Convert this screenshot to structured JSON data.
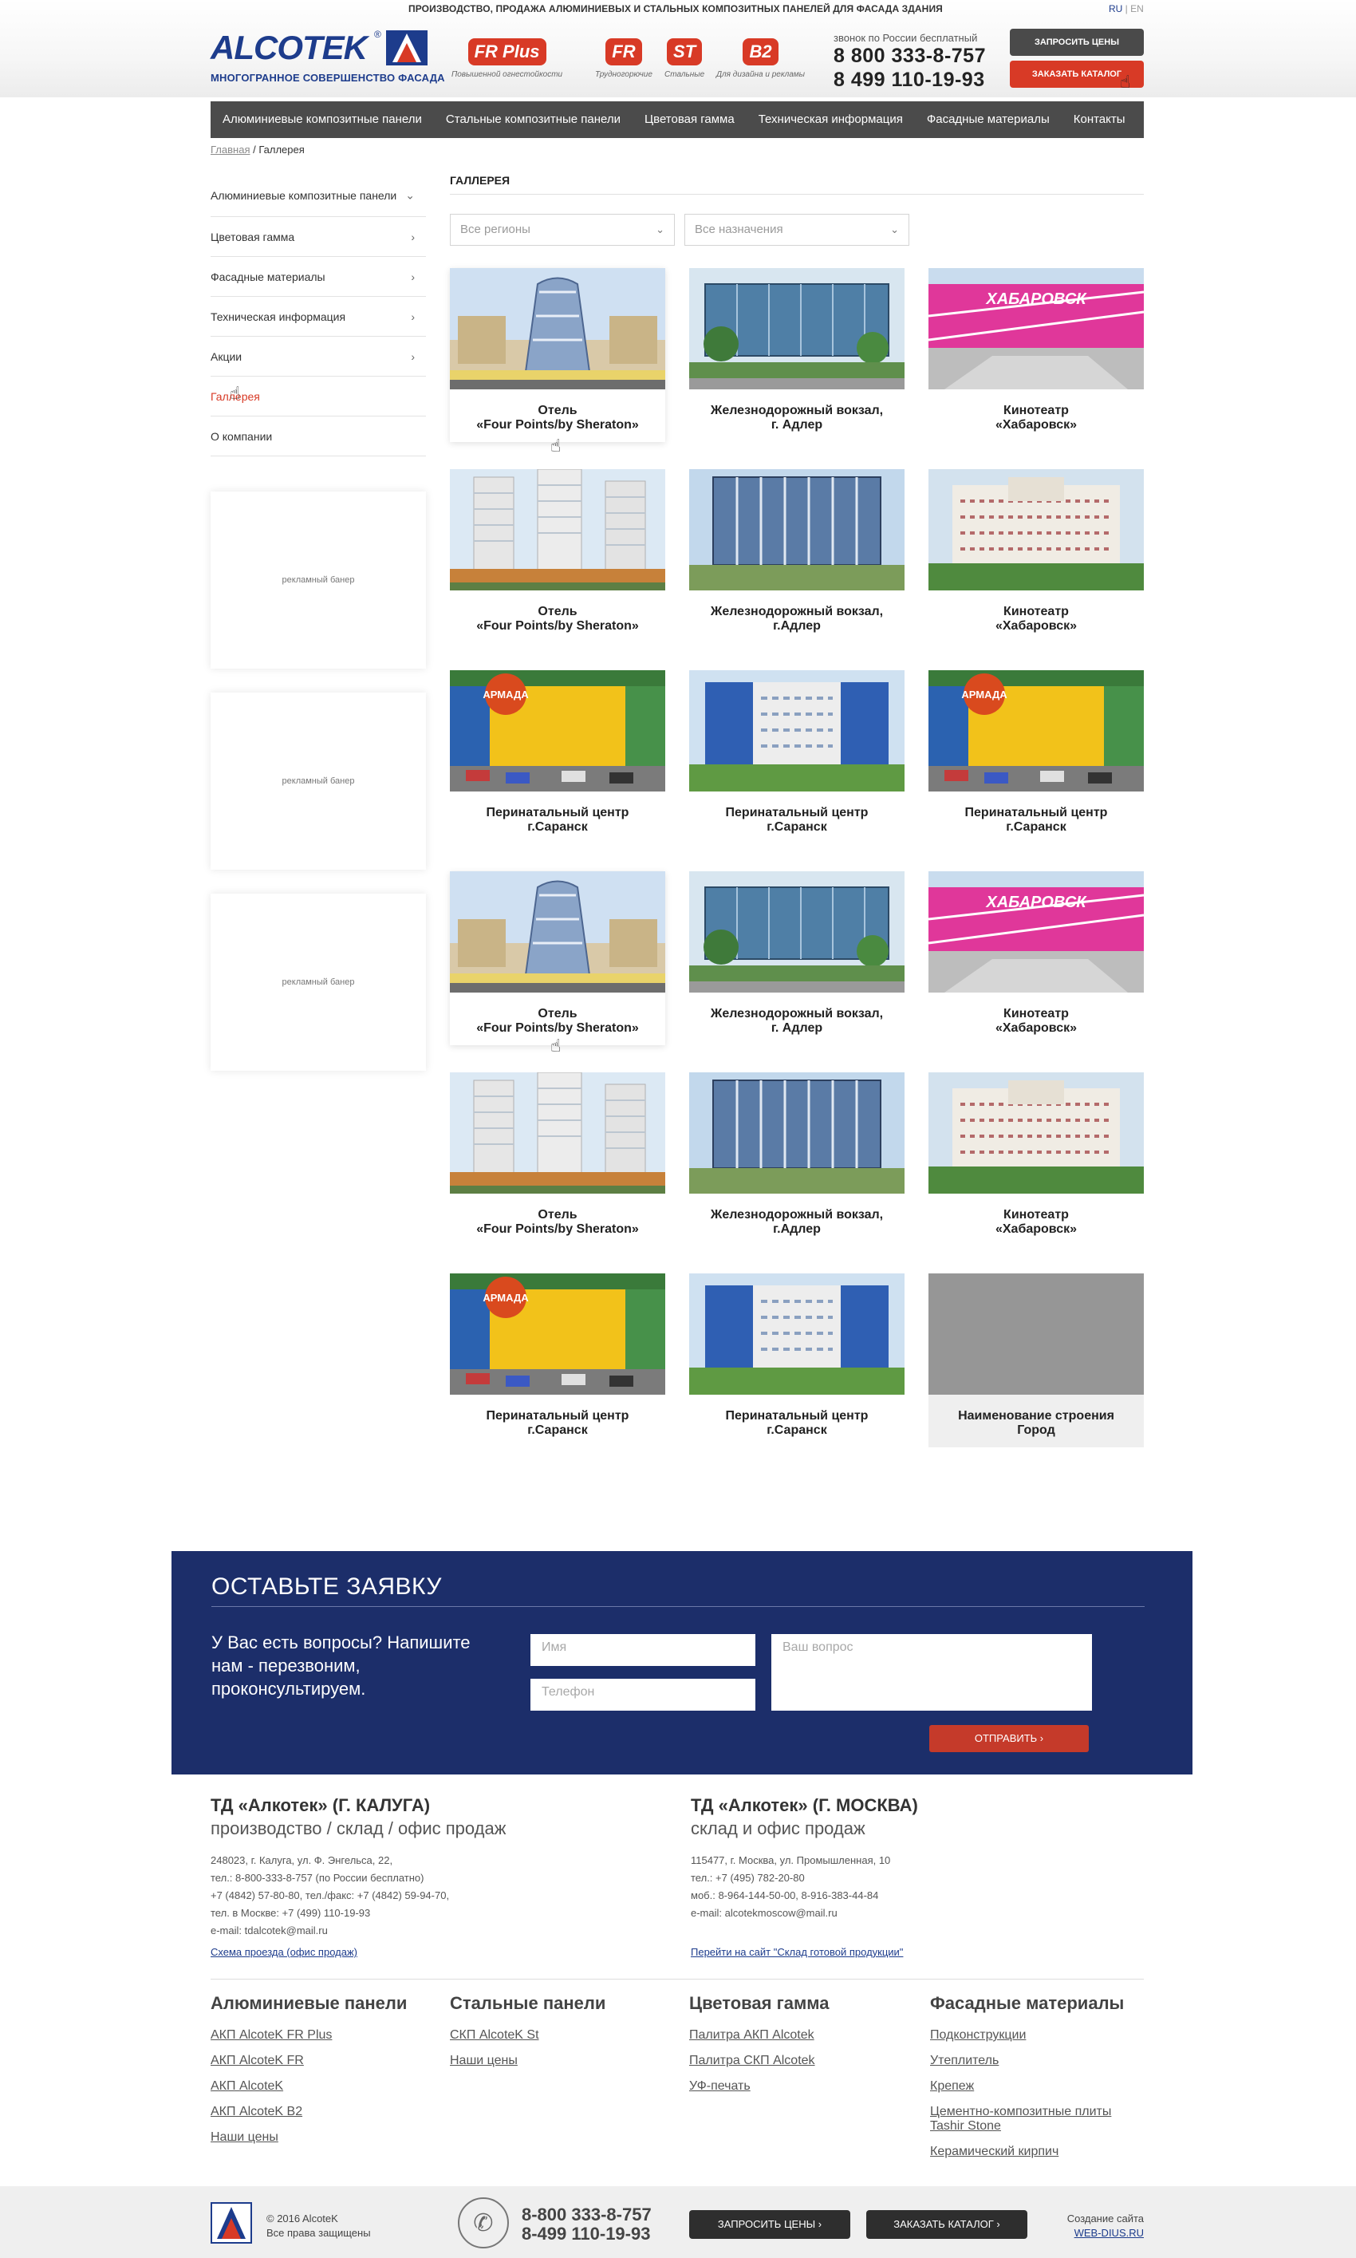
{
  "header": {
    "tagline": "ПРОИЗВОДСТВО, ПРОДАЖА АЛЮМИНИЕВЫХ И СТАЛЬНЫХ КОМПОЗИТНЫХ ПАНЕЛЕЙ ДЛЯ ФАСАДА ЗДАНИЯ",
    "lang_ru": "RU",
    "lang_sep": " | ",
    "lang_en": "EN",
    "logo_text": "ALCOTEK",
    "logo_subtitle": "МНОГОГРАННОЕ СОВЕРШЕНСТВО ФАСАДА",
    "badges": [
      {
        "label": "FR Plus",
        "caption": "Повышенной огнестойкости"
      },
      {
        "label": "FR",
        "caption": "Трудногорючие"
      },
      {
        "label": "ST",
        "caption": "Стальные"
      },
      {
        "label": "B2",
        "caption": "Для дизайна и рекламы"
      }
    ],
    "phone_note": "звонок по России бесплатный",
    "phone_1": "8 800 333-8-757",
    "phone_2": "8 499 110-19-93",
    "btn_prices": "ЗАПРОСИТЬ ЦЕНЫ",
    "btn_catalog": "ЗАКАЗАТЬ КАТАЛОГ"
  },
  "nav": [
    "Алюминиевые композитные панели",
    "Стальные композитные панели",
    "Цветовая гамма",
    "Техническая информация",
    "Фасадные материалы",
    "Контакты"
  ],
  "breadcrumb": {
    "home": "Главная",
    "sep": " / ",
    "current": "Галлерея"
  },
  "sidebar": [
    {
      "label": "Алюминиевые композитные панели",
      "state": "expanded"
    },
    {
      "label": "Цветовая гамма"
    },
    {
      "label": "Фасадные материалы"
    },
    {
      "label": "Техническая информация"
    },
    {
      "label": "Акции"
    },
    {
      "label": "Галлерея",
      "state": "active"
    },
    {
      "label": "О компании"
    }
  ],
  "ads": [
    "рекламный банер",
    "рекламный банер",
    "рекламный банер"
  ],
  "gallery": {
    "title": "ГАЛЛЕРЕЯ",
    "filter_region": "Все регионы",
    "filter_purpose": "Все назначения",
    "items": [
      {
        "l1": "Отель",
        "l2": "«Four Points/by Sheraton»",
        "pic": "hotel-dome"
      },
      {
        "l1": "Железнодорожный вокзал,",
        "l2": "г. Адлер",
        "pic": "station-glass"
      },
      {
        "l1": "Кинотеатр",
        "l2": "«Хабаровск»",
        "pic": "cinema-pink"
      },
      {
        "l1": "Отель",
        "l2": "«Four Points/by Sheraton»",
        "pic": "towers"
      },
      {
        "l1": "Железнодорожный вокзал,",
        "l2": "г.Адлер",
        "pic": "station-blue"
      },
      {
        "l1": "Кинотеатр",
        "l2": "«Хабаровск»",
        "pic": "cinema-white"
      },
      {
        "l1": "Перинатальный центр",
        "l2": "г.Саранск",
        "pic": "mall-yellow"
      },
      {
        "l1": "Перинатальный центр",
        "l2": "г.Саранск",
        "pic": "hospital-blue"
      },
      {
        "l1": "Перинатальный центр",
        "l2": "г.Саранск",
        "pic": "mall-yellow"
      },
      {
        "l1": "Отель",
        "l2": "«Four Points/by Sheraton»",
        "pic": "hotel-dome"
      },
      {
        "l1": "Железнодорожный вокзал,",
        "l2": "г. Адлер",
        "pic": "station-glass"
      },
      {
        "l1": "Кинотеатр",
        "l2": "«Хабаровск»",
        "pic": "cinema-pink"
      },
      {
        "l1": "Отель",
        "l2": "«Four Points/by Sheraton»",
        "pic": "towers"
      },
      {
        "l1": "Железнодорожный вокзал,",
        "l2": "г.Адлер",
        "pic": "station-blue"
      },
      {
        "l1": "Кинотеатр",
        "l2": "«Хабаровск»",
        "pic": "cinema-white"
      },
      {
        "l1": "Перинатальный центр",
        "l2": "г.Саранск",
        "pic": "mall-yellow"
      },
      {
        "l1": "Перинатальный центр",
        "l2": "г.Саранск",
        "pic": "hospital-blue"
      },
      {
        "l1": "Наименование строения",
        "l2": "Город",
        "pic": "placeholder"
      }
    ]
  },
  "cinema_sign": "ХАБАРОВСК",
  "mall_sign": "АРМАДА",
  "form": {
    "title": "ОСТАВЬТЕ ЗАЯВКУ",
    "text": "У Вас есть вопросы? Напишите нам - перезвоним, проконсультируем.",
    "name_placeholder": "Имя",
    "phone_placeholder": "Телефон",
    "question_placeholder": "Ваш вопрос",
    "send": "ОТПРАВИТЬ  ›"
  },
  "offices": [
    {
      "title": "ТД «Алкотек» (Г. КАЛУГА)",
      "subtitle": "производство / склад / офис продаж",
      "lines": [
        "248023, г. Калуга, ул. Ф. Энгельса, 22,",
        "тел.: 8-800-333-8-757 (по России бесплатно)",
        "+7 (4842) 57-80-80, тел./факс: +7 (4842) 59-94-70,",
        "тел. в Москве: +7 (499) 110-19-93",
        "e-mail: tdalcotek@mail.ru"
      ],
      "link": "Схема проезда (офис продаж)"
    },
    {
      "title": "ТД «Алкотек» (Г. МОСКВА)",
      "subtitle": "склад и офис продаж",
      "lines": [
        "115477, г. Москва, ул. Промышленная, 10",
        "тел.: +7 (495) 782-20-80",
        "моб.: 8-964-144-50-00, 8-916-383-44-84",
        "e-mail: alcotekmoscow@mail.ru"
      ],
      "link": "Перейти на сайт \"Склад готовой продукции\""
    }
  ],
  "footer_cols": [
    {
      "title": "Алюминиевые панели",
      "links": [
        "АКП AlcoteK FR Plus",
        "АКП AlcoteK FR",
        "АКП AlcoteK ",
        "АКП AlcoteK B2",
        "Наши цены"
      ]
    },
    {
      "title": "Стальные панели",
      "links": [
        "СКП AlcoteK St",
        "Наши цены"
      ]
    },
    {
      "title": "Цветовая гамма",
      "links": [
        "Палитра АКП Alcotek ",
        "Палитра СКП Alcotek ",
        "УФ-печать"
      ]
    },
    {
      "title": "Фасадные материалы",
      "links": [
        "Подконструкции",
        "Утеплитель",
        "Крепеж",
        "Цементно-композитные плиты Tashir Stone",
        "Керамический кирпич"
      ]
    }
  ],
  "bottom": {
    "copyright": "© 2016 AlcoteK",
    "rights": "Все права защищены",
    "phone_1": "8-800 333-8-757",
    "phone_2": "8-499 110-19-93",
    "btn_prices": "ЗАПРОСИТЬ ЦЕНЫ  ›",
    "btn_catalog": "ЗАКАЗАТЬ КАТАЛОГ  ›",
    "made_by": "Создание сайта",
    "studio": "WEB-DIUS.RU"
  },
  "colors": {
    "brand_blue": "#1d3c8c",
    "accent_red": "#d83a26",
    "nav_gray": "#4b4b4b",
    "form_navy": "#1c2e6a"
  }
}
